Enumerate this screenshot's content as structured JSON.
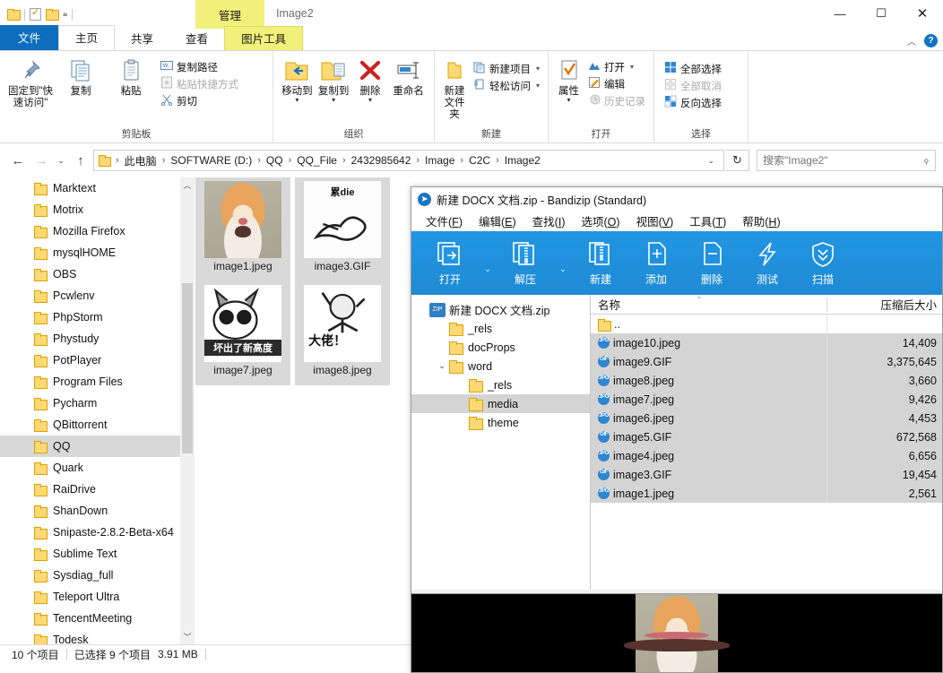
{
  "explorer": {
    "window_title": "Image2",
    "quick_access": {
      "icons": [
        "folder-icon",
        "properties-icon",
        "new-folder-icon",
        "customize-dropdown-icon"
      ]
    },
    "contextual_tab_group": "管理",
    "tabs": [
      {
        "label": "文件",
        "kind": "file"
      },
      {
        "label": "主页",
        "kind": "active"
      },
      {
        "label": "共享",
        "kind": "normal"
      },
      {
        "label": "查看",
        "kind": "normal"
      },
      {
        "label": "图片工具",
        "kind": "tool"
      }
    ],
    "window_buttons": {
      "minimize": "—",
      "maximize": "☐",
      "close": "✕"
    },
    "ribbon": {
      "collapse_caret": "︿",
      "help": "?",
      "groups": [
        {
          "title": "剪贴板",
          "big": [
            {
              "label": "固定到\"快速访问\"",
              "icon": "pin-icon"
            },
            {
              "label": "复制",
              "icon": "copy-icon"
            },
            {
              "label": "粘贴",
              "icon": "paste-icon"
            }
          ],
          "small": [
            {
              "label": "复制路径",
              "icon": "copy-path-icon",
              "disabled": false
            },
            {
              "label": "粘贴快捷方式",
              "icon": "paste-shortcut-icon",
              "disabled": true
            },
            {
              "label": "剪切",
              "icon": "scissors-icon",
              "disabled": false
            }
          ]
        },
        {
          "title": "组织",
          "big": [
            {
              "label": "移动到",
              "icon": "move-to-icon",
              "caret": true
            },
            {
              "label": "复制到",
              "icon": "copy-to-icon",
              "caret": true
            },
            {
              "label": "删除",
              "icon": "delete-icon",
              "caret": true
            },
            {
              "label": "重命名",
              "icon": "rename-icon",
              "caret": false
            }
          ],
          "small": []
        },
        {
          "title": "新建",
          "big": [
            {
              "label": "新建文件夹",
              "icon": "new-folder-icon"
            }
          ],
          "small": [
            {
              "label": "新建项目",
              "icon": "new-item-icon",
              "caret": true
            },
            {
              "label": "轻松访问",
              "icon": "easy-access-icon",
              "caret": true
            }
          ]
        },
        {
          "title": "打开",
          "big": [
            {
              "label": "属性",
              "icon": "properties-icon",
              "caret": true
            }
          ],
          "small": [
            {
              "label": "打开",
              "icon": "open-icon",
              "caret": true,
              "disabled": false
            },
            {
              "label": "编辑",
              "icon": "edit-icon",
              "disabled": false
            },
            {
              "label": "历史记录",
              "icon": "history-icon",
              "disabled": true
            }
          ]
        },
        {
          "title": "选择",
          "big": [],
          "small": [
            {
              "label": "全部选择",
              "icon": "select-all-icon",
              "disabled": false
            },
            {
              "label": "全部取消",
              "icon": "select-none-icon",
              "disabled": true
            },
            {
              "label": "反向选择",
              "icon": "invert-selection-icon",
              "disabled": false
            }
          ]
        }
      ]
    },
    "address": {
      "back": "←",
      "forward": "→",
      "recent": "⌄",
      "up": "↑",
      "breadcrumbs": [
        "此电脑",
        "SOFTWARE (D:)",
        "QQ",
        "QQ_File",
        "2432985642",
        "Image",
        "C2C",
        "Image2"
      ],
      "dropdown": "⌄",
      "refresh": "↻",
      "search_placeholder": "搜索\"Image2\"",
      "search_value": ""
    },
    "nav_pane": {
      "items": [
        {
          "label": "Marktext",
          "selected": false
        },
        {
          "label": "Motrix",
          "selected": false
        },
        {
          "label": "Mozilla Firefox",
          "selected": false
        },
        {
          "label": "mysqlHOME",
          "selected": false
        },
        {
          "label": "OBS",
          "selected": false
        },
        {
          "label": "Pcwlenv",
          "selected": false
        },
        {
          "label": "PhpStorm",
          "selected": false
        },
        {
          "label": "Phystudy",
          "selected": false
        },
        {
          "label": "PotPlayer",
          "selected": false
        },
        {
          "label": "Program Files",
          "selected": false
        },
        {
          "label": "Pycharm",
          "selected": false
        },
        {
          "label": "QBittorrent",
          "selected": false
        },
        {
          "label": "QQ",
          "selected": true
        },
        {
          "label": "Quark",
          "selected": false
        },
        {
          "label": "RaiDrive",
          "selected": false
        },
        {
          "label": "ShanDown",
          "selected": false
        },
        {
          "label": "Snipaste-2.8.2-Beta-x64",
          "selected": false
        },
        {
          "label": "Sublime Text",
          "selected": false
        },
        {
          "label": "Sysdiag_full",
          "selected": false
        },
        {
          "label": "Teleport Ultra",
          "selected": false
        },
        {
          "label": "TencentMeeting",
          "selected": false
        },
        {
          "label": "Todesk",
          "selected": false
        }
      ],
      "scroll_up": "︿",
      "scroll_down": "﹀"
    },
    "tiles": [
      {
        "name": "image1.jpeg",
        "art": "hamster",
        "caption": ""
      },
      {
        "name": "image3.GIF",
        "art": "white",
        "caption": "累die"
      },
      {
        "name": "image7.jpeg",
        "art": "cat",
        "caption": "坏出了新高度"
      },
      {
        "name": "image8.jpeg",
        "art": "dude",
        "caption": "大佬！"
      }
    ],
    "status": {
      "item_count": "10 个项目",
      "selected": "已选择 9 个项目",
      "size": "3.91 MB"
    }
  },
  "bandizip": {
    "title": "新建 DOCX 文档.zip - Bandizip (Standard)",
    "logo_icon": "bandizip-logo-icon",
    "menus": [
      {
        "text": "文件",
        "key": "F"
      },
      {
        "text": "编辑",
        "key": "E"
      },
      {
        "text": "查找",
        "key": "I"
      },
      {
        "text": "选项",
        "key": "O"
      },
      {
        "text": "视图",
        "key": "V"
      },
      {
        "text": "工具",
        "key": "T"
      },
      {
        "text": "帮助",
        "key": "H"
      }
    ],
    "toolbar": [
      {
        "label": "打开",
        "icon": "open-archive-icon",
        "dropdown": true
      },
      {
        "label": "解压",
        "icon": "extract-icon",
        "dropdown": true
      },
      {
        "label": "新建",
        "icon": "new-archive-icon",
        "dropdown": false
      },
      {
        "label": "添加",
        "icon": "add-files-icon",
        "dropdown": false
      },
      {
        "label": "删除",
        "icon": "remove-files-icon",
        "dropdown": false
      },
      {
        "label": "测试",
        "icon": "test-archive-icon",
        "dropdown": false
      },
      {
        "label": "扫描",
        "icon": "scan-shield-icon",
        "dropdown": false
      }
    ],
    "tree": [
      {
        "label": "新建 DOCX 文档.zip",
        "indent": 0,
        "icon": "zip-icon",
        "expander": "",
        "selected": false
      },
      {
        "label": "_rels",
        "indent": 1,
        "icon": "folder-icon",
        "expander": "",
        "selected": false
      },
      {
        "label": "docProps",
        "indent": 1,
        "icon": "folder-icon",
        "expander": "",
        "selected": false
      },
      {
        "label": "word",
        "indent": 1,
        "icon": "folder-icon",
        "expander": "⌄",
        "selected": false
      },
      {
        "label": "_rels",
        "indent": 2,
        "icon": "folder-icon",
        "expander": "",
        "selected": false
      },
      {
        "label": "media",
        "indent": 2,
        "icon": "folder-icon",
        "expander": "",
        "selected": true
      },
      {
        "label": "theme",
        "indent": 2,
        "icon": "folder-icon",
        "expander": "",
        "selected": false
      }
    ],
    "list": {
      "columns": [
        "名称",
        "压缩后大小"
      ],
      "rows": [
        {
          "name": "..",
          "size": "",
          "type": "parent",
          "selected": false
        },
        {
          "name": "image10.jpeg",
          "size": "14,409",
          "type": "JPG",
          "selected": true
        },
        {
          "name": "image9.GIF",
          "size": "3,375,645",
          "type": "GIF",
          "selected": true
        },
        {
          "name": "image8.jpeg",
          "size": "3,660",
          "type": "JPG",
          "selected": true
        },
        {
          "name": "image7.jpeg",
          "size": "9,426",
          "type": "JPG",
          "selected": true
        },
        {
          "name": "image6.jpeg",
          "size": "4,453",
          "type": "JPG",
          "selected": true
        },
        {
          "name": "image5.GIF",
          "size": "672,568",
          "type": "GIF",
          "selected": true
        },
        {
          "name": "image4.jpeg",
          "size": "6,656",
          "type": "JPG",
          "selected": true
        },
        {
          "name": "image3.GIF",
          "size": "19,454",
          "type": "GIF",
          "selected": true
        },
        {
          "name": "image1.jpeg",
          "size": "2,561",
          "type": "JPG",
          "selected": true
        }
      ]
    },
    "preview": {
      "image": "hamster-preview"
    }
  }
}
